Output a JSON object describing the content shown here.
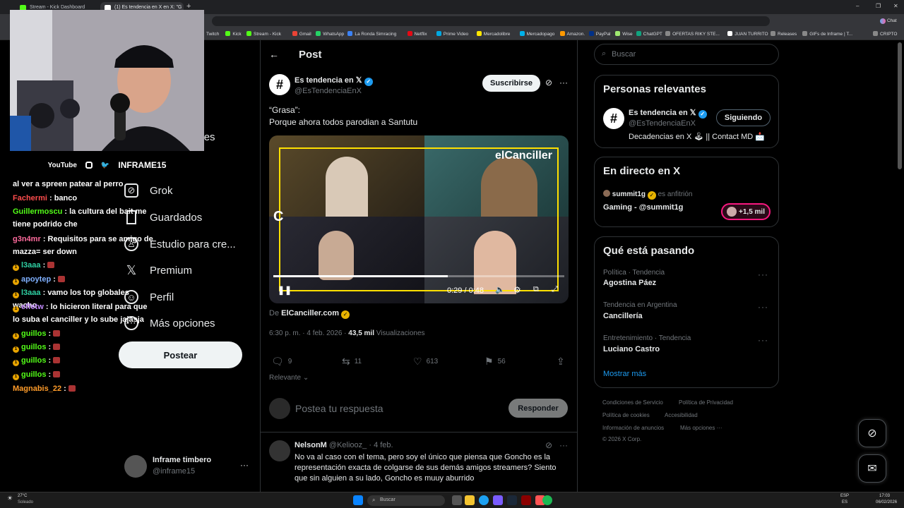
{
  "browser": {
    "tabs": [
      {
        "label": "Stream - Kick Dashboard",
        "color": "#53fc18"
      },
      {
        "label": "(1) Es tendencia en X en X: \"G",
        "color": "#ffffff"
      }
    ],
    "window_controls": {
      "minimize": "–",
      "restore": "❐",
      "close": "✕"
    },
    "bookmarks": [
      {
        "label": "Twitch",
        "color": "#9146ff"
      },
      {
        "label": "Kick",
        "color": "#53fc18"
      },
      {
        "label": "Stream - Kick",
        "color": "#53fc18"
      },
      {
        "label": "Gmail",
        "color": "#ea4335"
      },
      {
        "label": "WhatsApp",
        "color": "#25d366"
      },
      {
        "label": "La Ronda Simracing",
        "color": "#3b82f6"
      },
      {
        "label": "Netflix",
        "color": "#e50914"
      },
      {
        "label": "Prime Video",
        "color": "#00a8e1"
      },
      {
        "label": "Mercadolibre",
        "color": "#ffe600"
      },
      {
        "label": "Mercadopago",
        "color": "#00b1ea"
      },
      {
        "label": "Amazon.",
        "color": "#ff9900"
      },
      {
        "label": "PayPal",
        "color": "#003087"
      },
      {
        "label": "Wise",
        "color": "#9fe870"
      },
      {
        "label": "ChatGPT",
        "color": "#10a37f"
      },
      {
        "label": "OFERTAS RIKY STE...",
        "color": "#888888"
      },
      {
        "label": "JUAN TURRITO",
        "color": "#ffffff"
      },
      {
        "label": "Releases",
        "color": "#888888"
      },
      {
        "label": "GIFs de Inframe | T...",
        "color": "#888888"
      },
      {
        "label": "CRIPTO",
        "color": "#888888"
      }
    ],
    "chat_button": "Chat"
  },
  "webcam": {
    "socials": [
      "YouTube",
      "INFRAME15"
    ]
  },
  "chat": [
    {
      "user": "",
      "text": "al ver a spreen patear al perro",
      "color": "#ffffff"
    },
    {
      "user": "Fachermi",
      "text": ": banco",
      "color": "#ff4d4d"
    },
    {
      "user": "Guillermoscu",
      "text": ": la cultura del bait me tiene podrido che",
      "color": "#53fc18"
    },
    {
      "user": "g3n4mr",
      "text": ": Requisitos para se amigo de mazza= ser down",
      "color": "#ff6b9d"
    },
    {
      "user": "l3aaa",
      "text": ":",
      "color": "#2fd0a3"
    },
    {
      "user": "apoytep",
      "text": ":",
      "color": "#7fb0ff"
    },
    {
      "user": "l3aaa",
      "text": ": vamo los top globales wacho",
      "color": "#2fd0a3"
    },
    {
      "user": "effetw",
      "text": ": lo hicieron literal para que lo suba el canciller y lo sube jajasja",
      "color": "#c58cff"
    },
    {
      "user": "guillos",
      "text": ":",
      "color": "#53fc18"
    },
    {
      "user": "guillos",
      "text": ":",
      "color": "#53fc18"
    },
    {
      "user": "guillos",
      "text": ":",
      "color": "#53fc18"
    },
    {
      "user": "guillos",
      "text": ":",
      "color": "#53fc18"
    },
    {
      "user": "Magnabis_22",
      "text": ":",
      "color": "#ff9c2a"
    }
  ],
  "nav": {
    "items": [
      {
        "label": "Más opciones",
        "icon": "communities-icon"
      },
      {
        "label": "Grok",
        "icon": "grok-icon"
      },
      {
        "label": "Guardados",
        "icon": "bookmark-icon"
      },
      {
        "label": "Estudio para cre...",
        "icon": "creator-studio-icon"
      },
      {
        "label": "Premium",
        "icon": "x-premium-icon"
      },
      {
        "label": "Perfil",
        "icon": "profile-icon"
      },
      {
        "label": "Más opciones",
        "icon": "more-circle-icon"
      }
    ],
    "post_button": "Postear",
    "account": {
      "name": "Inframe timbero",
      "handle": "@inframe15"
    }
  },
  "post": {
    "header": "Post",
    "author_name": "Es tendencia en 𝕏",
    "author_handle": "@EsTendenciaEnX",
    "subscribe": "Suscribirse",
    "text_line1": "“Grasa”:",
    "text_line2": "Porque ahora todos parodian a Santutu",
    "video": {
      "time": "0:29 / 0:48",
      "progress": 0.6,
      "overlay_label": "elCanciller"
    },
    "source_prefix": "De",
    "source": "ElCanciller.com",
    "timestamp": "6:30 p. m. · 4 feb. 2026 ·",
    "views": "43,5 mil",
    "views_label": "Visualizaciones",
    "replies": "9",
    "reposts": "11",
    "likes": "613",
    "bookmarks": "56",
    "sort": "Relevante",
    "reply_placeholder": "Postea tu respuesta",
    "reply_button": "Responder"
  },
  "reply": {
    "name": "NelsonM",
    "handle": "@Keliooz_",
    "date": "· 4 feb.",
    "text": "No va al caso con el tema, pero soy el único que piensa que Goncho es la representación exacta de colgarse de sus demás amigos streamers? Siento que sin alguien a su lado, Goncho es muuy aburrido"
  },
  "right": {
    "search_placeholder": "Buscar",
    "relevant": {
      "title": "Personas relevantes",
      "name": "Es tendencia en 𝕏",
      "handle": "@EsTendenciaEnX",
      "bio": "Decadencias en X 🕹 || Contact MD 📩",
      "follow_button": "Siguiendo"
    },
    "live": {
      "title": "En directo en X",
      "host": "summit1g",
      "host_suffix": "es anfitrión",
      "stream": "Gaming - @summit1g",
      "listeners": "+1,5 mil"
    },
    "trends": {
      "title": "Qué está pasando",
      "items": [
        {
          "category": "Política · Tendencia",
          "name": "Agostina Páez"
        },
        {
          "category": "Tendencia en Argentina",
          "name": "Cancillería"
        },
        {
          "category": "Entretenimiento · Tendencia",
          "name": "Luciano Castro"
        }
      ],
      "more": "Mostrar más"
    },
    "footer": [
      "Condiciones de Servicio",
      "Política de Privacidad",
      "Política de cookies",
      "Accesibilidad",
      "Información de anuncios",
      "Más opciones ···",
      "© 2026 X Corp."
    ]
  },
  "taskbar": {
    "weather_temp": "27°C",
    "weather_text": "Soleado",
    "search": "Buscar",
    "lang": "ESP",
    "lang2": "ES",
    "time": "17:03",
    "date": "06/02/2026"
  }
}
